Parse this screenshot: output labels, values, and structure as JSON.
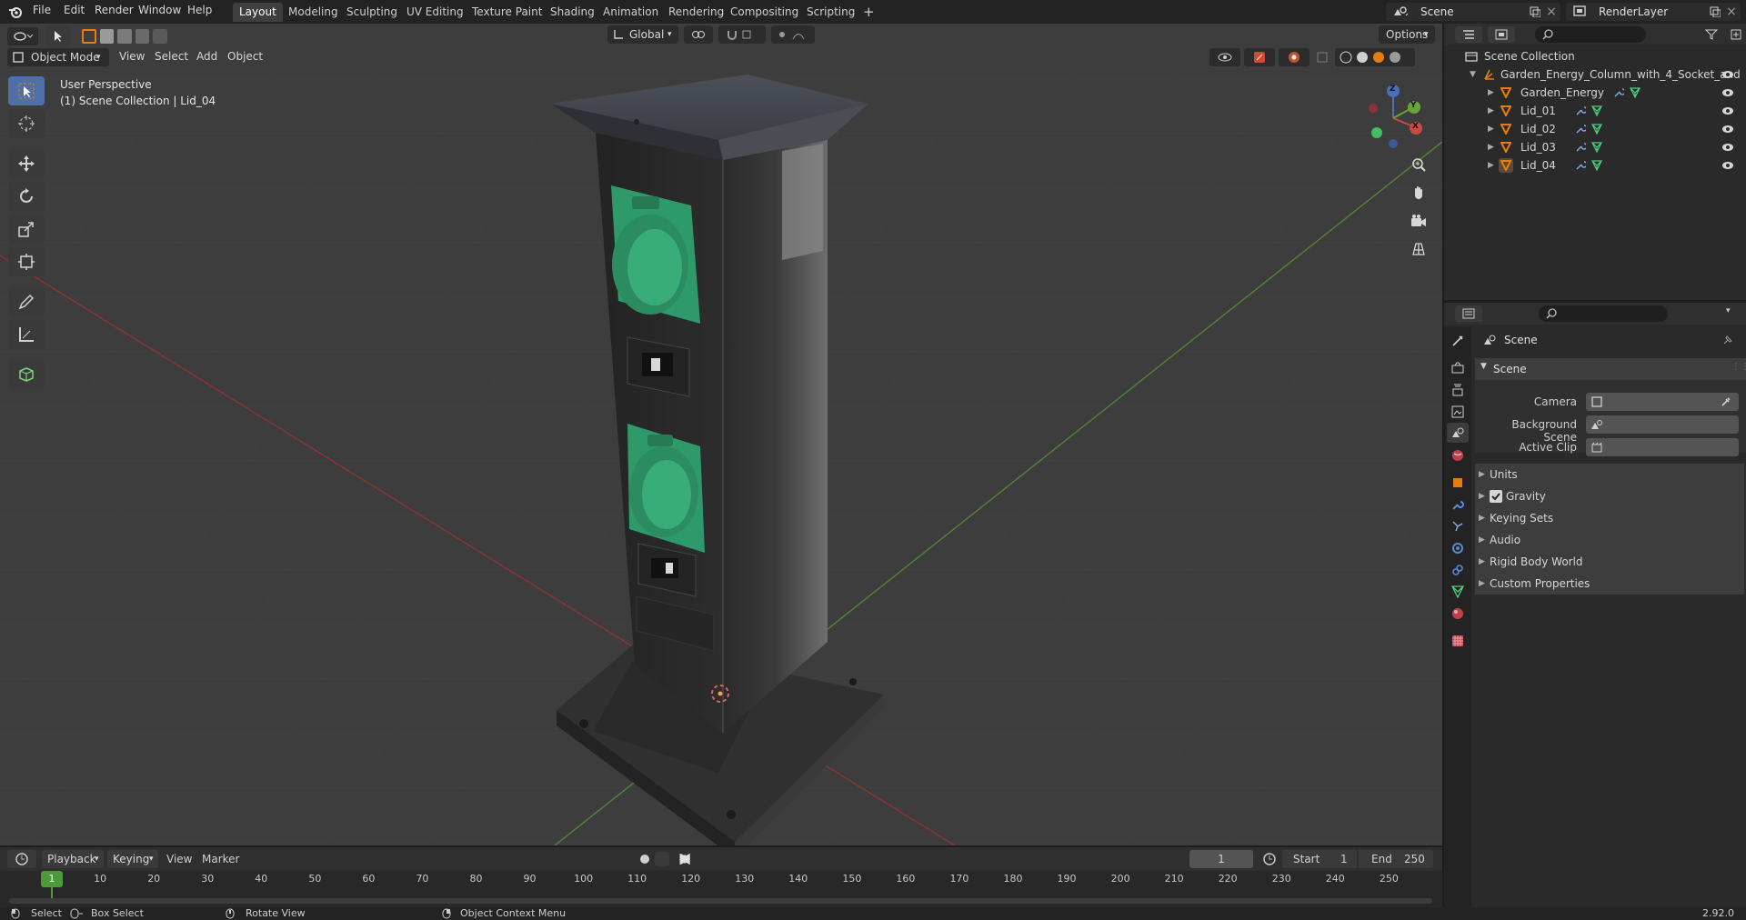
{
  "topbar": {
    "menus": [
      "File",
      "Edit",
      "Render",
      "Window",
      "Help"
    ],
    "workspaces": [
      "Layout",
      "Modeling",
      "Sculpting",
      "UV Editing",
      "Texture Paint",
      "Shading",
      "Animation",
      "Rendering",
      "Compositing",
      "Scripting"
    ],
    "active_workspace": "Layout",
    "add_tab": "+",
    "scene_name": "Scene",
    "view_layer": "RenderLayer"
  },
  "viewport_header": {
    "mode": "Object Mode",
    "menus": [
      "View",
      "Select",
      "Add",
      "Object"
    ],
    "orientation": "Global",
    "options": "Options"
  },
  "viewport": {
    "perspective": "User Perspective",
    "collection_info": "(1) Scene Collection | Lid_04",
    "gizmo_axes": {
      "x": "X",
      "y": "Y",
      "z": "Z"
    }
  },
  "outliner": {
    "root": "Scene Collection",
    "items": [
      {
        "name": "Garden_Energy_Column_with_4_Socket_and",
        "level": 1
      },
      {
        "name": "Garden_Energy",
        "level": 2
      },
      {
        "name": "Lid_01",
        "level": 2
      },
      {
        "name": "Lid_02",
        "level": 2
      },
      {
        "name": "Lid_03",
        "level": 2
      },
      {
        "name": "Lid_04",
        "level": 2
      }
    ]
  },
  "properties": {
    "context": "Scene",
    "section": "Scene",
    "fields": [
      {
        "label": "Camera"
      },
      {
        "label": "Background Scene"
      },
      {
        "label": "Active Clip"
      }
    ],
    "panels": [
      "Units",
      "Gravity",
      "Keying Sets",
      "Audio",
      "Rigid Body World",
      "Custom Properties"
    ],
    "gravity_checked": true
  },
  "timeline": {
    "menus": [
      "Playback",
      "Keying",
      "View",
      "Marker"
    ],
    "current_frame": "1",
    "start_label": "Start",
    "start": "1",
    "end_label": "End",
    "end": "250",
    "ticks": [
      "1",
      "10",
      "20",
      "30",
      "40",
      "50",
      "60",
      "70",
      "80",
      "90",
      "100",
      "110",
      "120",
      "130",
      "140",
      "150",
      "160",
      "170",
      "180",
      "190",
      "200",
      "210",
      "220",
      "230",
      "240",
      "250"
    ]
  },
  "statusbar": {
    "select": "Select",
    "box_select": "Box Select",
    "rotate": "Rotate View",
    "context_menu": "Object Context Menu",
    "version": "2.92.0"
  },
  "colors": {
    "accent": "#e87d0d",
    "active_tool": "#4f6fa8",
    "socket_green": "#2e9a6a",
    "x_axis": "#9a3d3d",
    "y_axis": "#5a8a3a"
  }
}
